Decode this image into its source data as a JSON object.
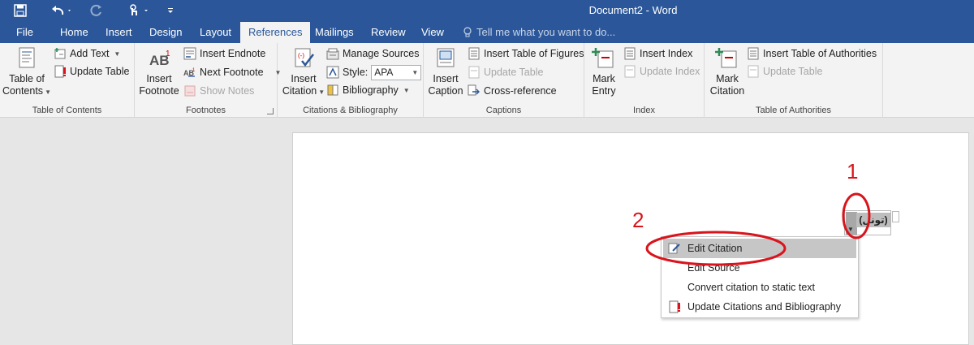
{
  "window": {
    "title": "Document2 - Word"
  },
  "tabs": [
    {
      "label": "File"
    },
    {
      "label": "Home"
    },
    {
      "label": "Insert"
    },
    {
      "label": "Design"
    },
    {
      "label": "Layout"
    },
    {
      "label": "References"
    },
    {
      "label": "Mailings"
    },
    {
      "label": "Review"
    },
    {
      "label": "View"
    }
  ],
  "tell_me": {
    "placeholder": "Tell me what you want to do..."
  },
  "ribbon": {
    "toc": {
      "group_label": "Table of Contents",
      "table_of_contents_line1": "Table of",
      "table_of_contents_line2": "Contents",
      "add_text": "Add Text",
      "update_table": "Update Table"
    },
    "footnotes": {
      "group_label": "Footnotes",
      "insert_footnote_line1": "Insert",
      "insert_footnote_line2": "Footnote",
      "insert_endnote": "Insert Endnote",
      "next_footnote": "Next Footnote",
      "show_notes": "Show Notes"
    },
    "citations": {
      "group_label": "Citations & Bibliography",
      "insert_citation_line1": "Insert",
      "insert_citation_line2": "Citation",
      "manage_sources": "Manage Sources",
      "style_label": "Style:",
      "style_value": "APA",
      "bibliography": "Bibliography"
    },
    "captions": {
      "group_label": "Captions",
      "insert_caption_line1": "Insert",
      "insert_caption_line2": "Caption",
      "insert_table_of_figures": "Insert Table of Figures",
      "update_table": "Update Table",
      "cross_reference": "Cross-reference"
    },
    "index": {
      "group_label": "Index",
      "mark_entry_line1": "Mark",
      "mark_entry_line2": "Entry",
      "insert_index": "Insert Index",
      "update_index": "Update Index"
    },
    "authorities": {
      "group_label": "Table of Authorities",
      "mark_citation_line1": "Mark",
      "mark_citation_line2": "Citation",
      "insert_table_of_authorities": "Insert Table of Authorities",
      "update_table": "Update Table"
    }
  },
  "citation": {
    "text": "(تونل)"
  },
  "context_menu": {
    "items": [
      {
        "label": "Edit Citation"
      },
      {
        "label": "Edit Source"
      },
      {
        "label": "Convert citation to static text"
      },
      {
        "label": "Update Citations and Bibliography"
      }
    ]
  },
  "annotations": {
    "step1": "1",
    "step2": "2"
  },
  "colors": {
    "title_bar": "#2b579a",
    "annotation": "#d9141c",
    "ribbon": "#f3f3f3"
  }
}
